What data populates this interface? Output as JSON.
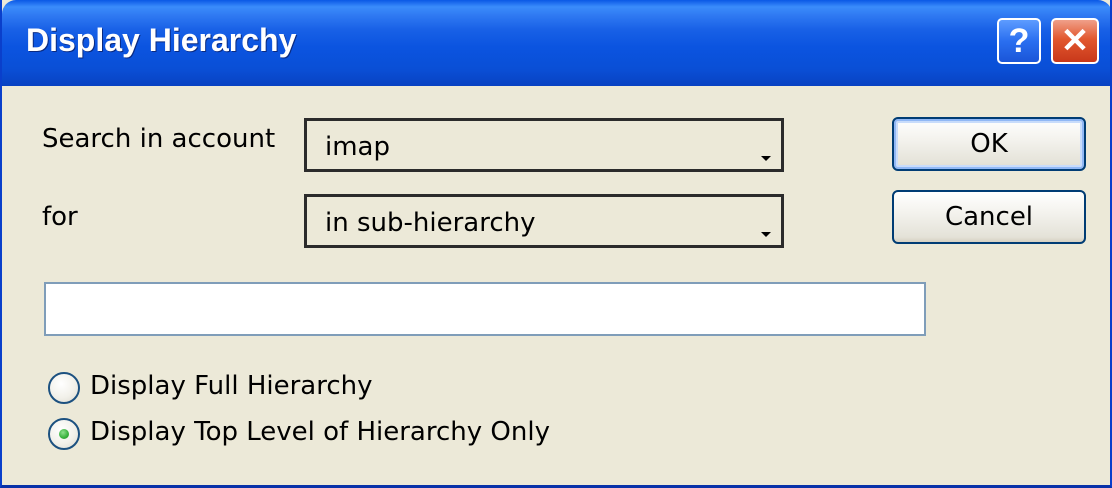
{
  "window": {
    "title": "Display Hierarchy",
    "help_glyph": "?",
    "close_glyph": "✕"
  },
  "form": {
    "account_label": "Search in account",
    "account_value": "imap",
    "for_label": "for",
    "for_value": "in sub-hierarchy",
    "search_text_value": ""
  },
  "buttons": {
    "ok_label": "OK",
    "cancel_label": "Cancel"
  },
  "options": [
    {
      "label": "Display Full Hierarchy",
      "checked": false
    },
    {
      "label": "Display Top Level of Hierarchy Only",
      "checked": true
    }
  ],
  "colors": {
    "titlebar": "#0a4fd6",
    "dialog_background": "#ece9d8",
    "radio_selected": "#36b03a"
  }
}
